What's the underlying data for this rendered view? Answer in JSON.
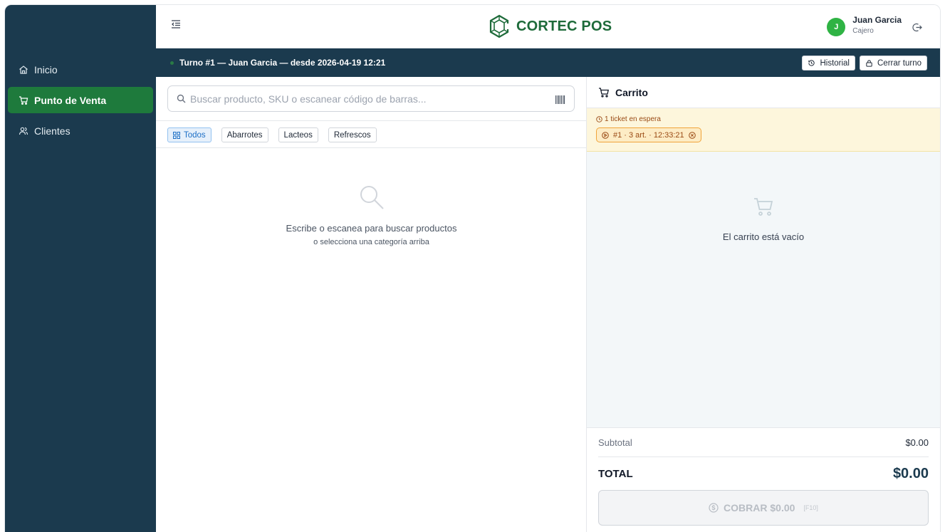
{
  "app": {
    "brand_name": "CORTEC POS"
  },
  "sidebar": {
    "items": [
      {
        "label": "Inicio",
        "icon": "home-icon",
        "active": false
      },
      {
        "label": "Punto de Venta",
        "icon": "cart-icon",
        "active": true
      },
      {
        "label": "Clientes",
        "icon": "users-icon",
        "active": false
      }
    ]
  },
  "header": {
    "user_initial": "J",
    "user_name": "Juan Garcia",
    "user_role": "Cajero",
    "avatar_color": "#2fb344"
  },
  "shift": {
    "text": "Turno #1 — Juan Garcia — desde 2026-04-19 12:21",
    "history_label": "Historial",
    "close_label": "Cerrar turno"
  },
  "search": {
    "placeholder": "Buscar producto, SKU o escanear código de barras...",
    "value": ""
  },
  "categories": [
    {
      "label": "Todos",
      "active": true
    },
    {
      "label": "Abarrotes",
      "active": false
    },
    {
      "label": "Lacteos",
      "active": false
    },
    {
      "label": "Refrescos",
      "active": false
    }
  ],
  "products_empty": {
    "message": "Escribe o escanea para buscar productos",
    "sub": "o selecciona una categoría arriba"
  },
  "cart": {
    "title": "Carrito",
    "hold_label": "1 ticket en espera",
    "held_ticket": "#1 · 3 art. · 12:33:21",
    "empty_message": "El carrito está vacío",
    "subtotal_label": "Subtotal",
    "subtotal_value": "$0.00",
    "total_label": "TOTAL",
    "total_value": "$0.00",
    "pay_label": "COBRAR $0.00",
    "pay_shortcut": "[F10]"
  },
  "colors": {
    "sidebar_bg": "#1b3a4e",
    "active_nav": "#1e7a3c",
    "brand": "#1e6b3a",
    "hold_bg": "#fdf6dc"
  }
}
